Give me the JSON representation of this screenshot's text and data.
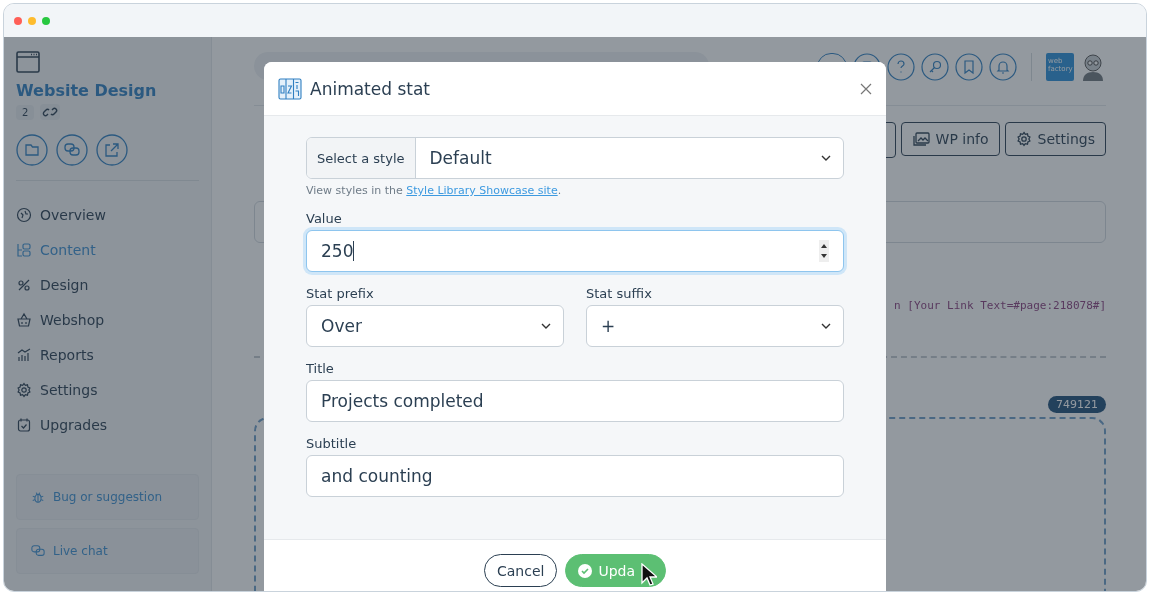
{
  "window": {
    "controls": [
      {
        "color": "#ff5f57"
      },
      {
        "color": "#febc2e"
      },
      {
        "color": "#28c840"
      }
    ]
  },
  "sidebar": {
    "project": {
      "title": "Website Design",
      "count": "2"
    },
    "nav": [
      {
        "label": "Overview",
        "selected": false
      },
      {
        "label": "Content",
        "selected": true
      },
      {
        "label": "Design",
        "selected": false
      },
      {
        "label": "Webshop",
        "selected": false
      },
      {
        "label": "Reports",
        "selected": false
      },
      {
        "label": "Settings",
        "selected": false
      },
      {
        "label": "Upgrades",
        "selected": false
      }
    ],
    "actions": [
      "Bug or suggestion",
      "Live chat"
    ]
  },
  "topbar": {
    "logo": "web factory"
  },
  "toolbar": {
    "buttons": [
      "WP info",
      "Settings"
    ]
  },
  "editor": {
    "code_text": "n [Your Link Text=#page:218078#]",
    "block_id": "749121"
  },
  "dialog": {
    "title": "Animated stat",
    "style": {
      "addon": "Select a style",
      "value": "Default",
      "help": "View styles in the ",
      "help_link": "Style Library Showcase site",
      "help_end": "."
    },
    "rows": [
      [
        {
          "kind": "number",
          "label": "Value",
          "value": "250",
          "focused": true
        }
      ],
      [
        {
          "kind": "select",
          "label": "Stat prefix",
          "value": "Over",
          "focused": false
        },
        {
          "kind": "select",
          "label": "Stat suffix",
          "value": "+",
          "focused": false
        }
      ],
      [
        {
          "kind": "text",
          "label": "Title",
          "value": "Projects completed",
          "focused": false
        }
      ],
      [
        {
          "kind": "text",
          "label": "Subtitle",
          "value": "and counting",
          "focused": false
        }
      ]
    ],
    "buttons": [
      {
        "kind": "secondary",
        "label": "Cancel"
      },
      {
        "kind": "primary",
        "label": "Upda"
      }
    ]
  }
}
